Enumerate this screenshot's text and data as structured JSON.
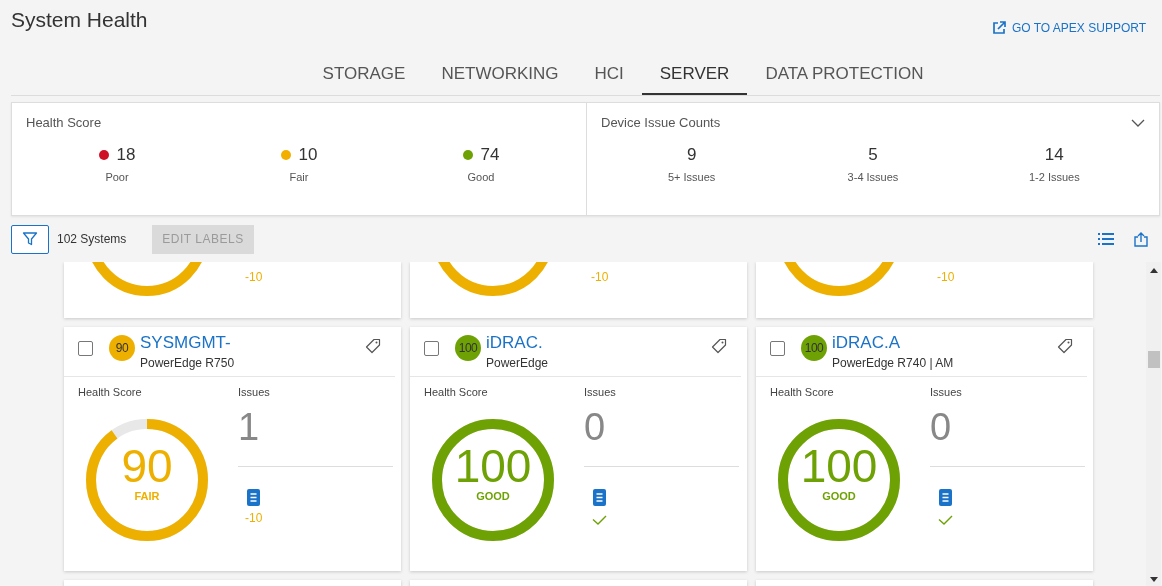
{
  "page": {
    "title": "System Health",
    "support_link": "GO TO APEX SUPPORT"
  },
  "tabs": [
    {
      "label": "STORAGE",
      "selected": false
    },
    {
      "label": "NETWORKING",
      "selected": false
    },
    {
      "label": "HCI",
      "selected": false
    },
    {
      "label": "SERVER",
      "selected": true
    },
    {
      "label": "DATA PROTECTION",
      "selected": false
    }
  ],
  "summary": {
    "health": {
      "title": "Health Score",
      "items": [
        {
          "count": "18",
          "label": "Poor",
          "color": "#ce1126"
        },
        {
          "count": "10",
          "label": "Fair",
          "color": "#f2af00"
        },
        {
          "count": "74",
          "label": "Good",
          "color": "#6ea204"
        }
      ]
    },
    "issues": {
      "title": "Device Issue Counts",
      "expanded": false,
      "items": [
        {
          "count": "9",
          "label": "5+ Issues"
        },
        {
          "count": "5",
          "label": "3-4 Issues"
        },
        {
          "count": "14",
          "label": "1-2 Issues"
        }
      ]
    }
  },
  "toolbar": {
    "count": "102 Systems",
    "edit_button": {
      "label": "EDIT LABELS",
      "disabled": true
    }
  },
  "cards_above": [
    {
      "kind": "fair",
      "delta": "-10"
    },
    {
      "kind": "fair",
      "delta": "-10"
    },
    {
      "kind": "fair",
      "delta": "-10"
    }
  ],
  "cards": [
    {
      "checked": false,
      "badge_score": "90",
      "score": "90",
      "kind": "fair",
      "title": "SYSMGMT-",
      "subtitle": "PowerEdge R750",
      "health_label": "Health Score",
      "level": 0.9,
      "status_label": "FAIR",
      "issues_label": "Issues",
      "issues": "1",
      "result": {
        "kind": "delta",
        "text": "-10"
      }
    },
    {
      "checked": false,
      "badge_score": "100",
      "score": "100",
      "kind": "good",
      "title": "iDRAC.",
      "subtitle": "PowerEdge",
      "health_label": "Health Score",
      "level": 1,
      "status_label": "GOOD",
      "issues_label": "Issues",
      "issues": "0",
      "result": {
        "kind": "ok"
      }
    },
    {
      "checked": false,
      "badge_score": "100",
      "score": "100",
      "kind": "good",
      "title": "iDRAC.A",
      "subtitle": "PowerEdge R740 | AM",
      "health_label": "Health Score",
      "level": 1,
      "status_label": "GOOD",
      "issues_label": "Issues",
      "issues": "0",
      "result": {
        "kind": "ok"
      }
    }
  ]
}
